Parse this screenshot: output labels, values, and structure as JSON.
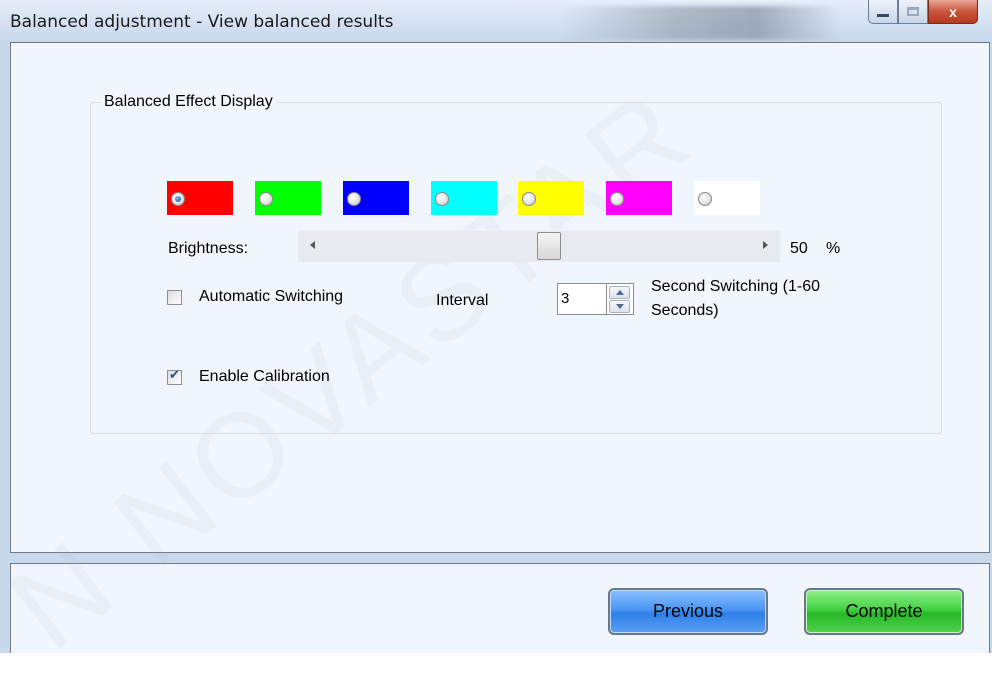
{
  "window": {
    "title": "Balanced adjustment - View balanced results",
    "close_label": "x"
  },
  "group": {
    "title": "Balanced Effect Display"
  },
  "colors": [
    {
      "name": "red",
      "hex": "#ff0000",
      "checked": true
    },
    {
      "name": "green",
      "hex": "#00ff00",
      "checked": false
    },
    {
      "name": "blue",
      "hex": "#0000ff",
      "checked": false
    },
    {
      "name": "cyan",
      "hex": "#00ffff",
      "checked": false
    },
    {
      "name": "yellow",
      "hex": "#ffff00",
      "checked": false
    },
    {
      "name": "magenta",
      "hex": "#ff00ff",
      "checked": false
    },
    {
      "name": "white",
      "hex": "#ffffff",
      "checked": false
    }
  ],
  "brightness": {
    "label": "Brightness:",
    "value": "50",
    "unit": "%",
    "level_percent": 50
  },
  "auto_switch": {
    "label": "Automatic Switching",
    "checked": false,
    "interval_label": "Interval",
    "interval_value": "3",
    "suffix_line1": "Second Switching (1-60",
    "suffix_line2": "Seconds)"
  },
  "calibration": {
    "label": "Enable Calibration",
    "checked": true
  },
  "buttons": {
    "previous": "Previous",
    "complete": "Complete"
  },
  "watermark": "N NOVASTAR"
}
